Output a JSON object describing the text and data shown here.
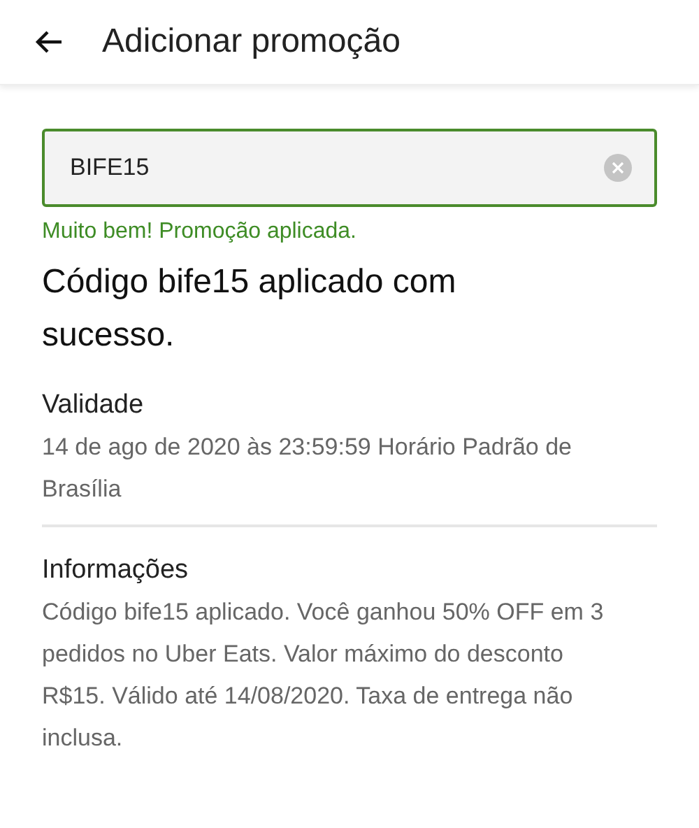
{
  "header": {
    "title": "Adicionar promoção"
  },
  "promo_field": {
    "value": "BIFE15",
    "valid": true
  },
  "field_message": "Muito bem! Promoção aplicada.",
  "result_heading": "Código bife15 aplicado com sucesso.",
  "sections": [
    {
      "title": "Validade",
      "text": "14 de ago de 2020 às 23:59:59 Horário Padrão de Brasília"
    },
    {
      "title": "Informações",
      "text": "Código bife15 aplicado. Você ganhou 50% OFF em 3 pedidos no Uber Eats. Valor máximo do desconto R$15. Válido até 14/08/2020. Taxa de entrega não inclusa."
    }
  ]
}
